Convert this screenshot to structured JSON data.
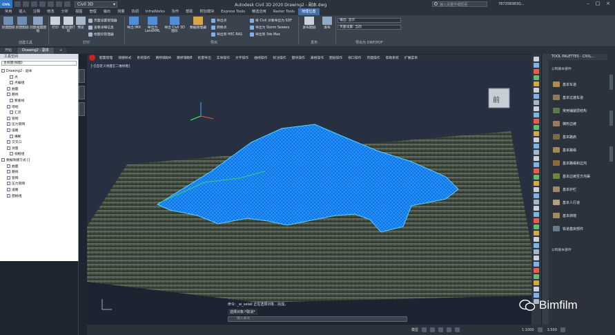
{
  "app": {
    "button_label": "CIVIL",
    "workspace": "Civil 3D",
    "title": "Autodesk Civil 3D 2020   Drawing2 - 副本.dwg",
    "search_placeholder": "输入关键字或短语",
    "user": "787358383Q..."
  },
  "ribbon_tabs": [
    "常用",
    "插入",
    "注释",
    "修改",
    "分析",
    "视图",
    "管理",
    "输出",
    "测量",
    "协调",
    "InfraWorks",
    "协作",
    "帮助",
    "附加模块",
    "Express Tools",
    "精选应用",
    "Raster Tools",
    "地理位置"
  ],
  "ribbon_active": "地理位置",
  "ribbon": {
    "b1": "创建图纸",
    "b2": "创建图纸",
    "b3": "创建视图图纸",
    "panel1": "创建工具",
    "b4": "打印",
    "b5": "批处理打印",
    "b6": "预览",
    "s1": "页面设置管理器",
    "s2": "查看详细信息",
    "s3": "绘图仪管理器",
    "panel2": "打印",
    "b7": "导出 IMX",
    "b8": "导出为 LandXML",
    "b9": "导出 Civil 3D 图形",
    "b10": "数据管理器",
    "s4": "导出点",
    "s5": "转换点",
    "s6": "导出到 HEC RAS",
    "s7": "将 Civil 对象导出为 SDF",
    "s8": "导出为 Storm Sewers",
    "s9": "导出到 3ds Max",
    "panel3": "导出",
    "b11": "发布",
    "b12": "发布图纸",
    "panel4": "发布",
    "dd1": "输出: 显示",
    "dd2": "页面设置: 当前",
    "panel5": "导出为 DWF/PDF"
  },
  "doc_tabs": [
    "开始",
    "Drawing2 - 副本"
  ],
  "doc_active": "Drawing2 - 副本",
  "toolspace": {
    "title": "工具空间",
    "combo": "主视图(视图)",
    "tree": [
      "Drawing2 - 副本",
      "点",
      "点编组",
      "曲面",
      "路线",
      "要素线",
      "场地",
      "汇流",
      "管网",
      "压力管网",
      "道路",
      "横断",
      "交叉口",
      "测量",
      "视框组",
      "数据快捷方式 []",
      "曲面",
      "路线",
      "管网",
      "压力管网",
      "道路",
      "图幅组"
    ]
  },
  "menubar": [
    "配置管理",
    "快捷样式",
    "系统操作",
    "路桥辅助A",
    "路桥辅助B",
    "批量导出",
    "实体操作",
    "文字操作",
    "曲线操作",
    "标注操作",
    "图块操作",
    "表格操作",
    "图层操作",
    "视口操作",
    "页面操作",
    "帮助系统",
    "扩展菜单"
  ],
  "viewport": {
    "label": "[-][自定义视图][二维线框]",
    "cmd_line1": "命令: _ai_selall 正在选择对象...完成。",
    "cmd_line2": "选择对象:*取消*",
    "cmd_placeholder": "键入命令",
    "viewcube_face": "前"
  },
  "palette": {
    "title": "TOOL PALETTES - CIVIL...",
    "cat_top": "公制基本部件",
    "items": [
      "基本车道",
      "基本过渡车道",
      "常用铺装层结构",
      "梯形边坡",
      "基本路肩",
      "基本路缘",
      "基本路缘和边沟",
      "基本边坡至方沟渠",
      "基本护栏",
      "基本人行道",
      "基本挡墙",
      "铁道基床部件"
    ],
    "cat_bottom": "公制基本部件"
  },
  "status": {
    "model": "模型",
    "scale": "1:1000",
    "zoom": "3.500"
  },
  "watermark": "Bimfilm",
  "colors": {
    "accent": "#3f6fa6",
    "mesh": "#1e90ff",
    "mesh_edge": "#5fd1ff"
  }
}
